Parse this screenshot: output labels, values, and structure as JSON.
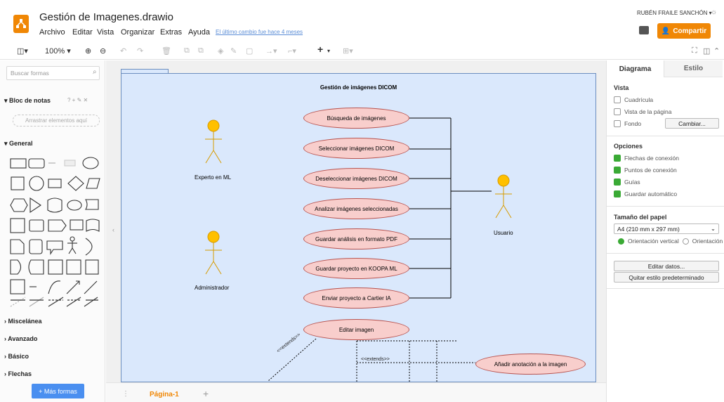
{
  "app": {
    "title": "Gestión de Imagenes.drawio",
    "last_change": "El último cambio fue hace 4 meses",
    "user": "RUBÉN FRAILE SANCHÓN ▾",
    "share": "Compartir"
  },
  "menu": [
    "Archivo",
    "Editar",
    "Vista",
    "Organizar",
    "Extras",
    "Ayuda"
  ],
  "toolbar": {
    "zoom": "100% ▾"
  },
  "left": {
    "search_placeholder": "Buscar formas",
    "scratchpad": "Bloc de notas",
    "scratchpad_tools": "? + ✎ ✕",
    "drag_hint": "Arrastrar elementos aquí",
    "general": "General",
    "sections": [
      "Miscelánea",
      "Avanzado",
      "Básico",
      "Flechas"
    ],
    "more_shapes": "+ Más formas"
  },
  "diagram": {
    "title": "Gestión de imágenes DICOM",
    "actors": [
      "Experto en ML",
      "Administrador",
      "Usuario"
    ],
    "use_cases": [
      "Búsqueda de imágenes",
      "Seleccionar imágenes DICOM",
      "Deseleccionar imágenes DICOM",
      "Analizar imágenes seleccionadas",
      "Guardar análisis en formato PDF",
      "Guardar proyecto en KOOPA ML",
      "Enviar proyecto a Cartier IA",
      "Editar imagen",
      "Añadir anotación a la imagen"
    ],
    "extends_1": "<<extends>>",
    "extends_2": "<<extends>>"
  },
  "bottom": {
    "page": "Página-1",
    "add": "+"
  },
  "right": {
    "tabs": [
      "Diagrama",
      "Estilo"
    ],
    "vista": "Vista",
    "grid": "Cuadrícula",
    "page_view": "Vista de la página",
    "background": "Fondo",
    "change": "Cambiar...",
    "options": "Opciones",
    "options_items": [
      "Flechas de conexión",
      "Puntos de conexión",
      "Guías",
      "Guardar automático"
    ],
    "paper": "Tamaño del papel",
    "paper_value": "A4 (210 mm x 297 mm)",
    "portrait": "Orientación vertical",
    "landscape": "Orientación",
    "edit_data": "Editar datos...",
    "clear_style": "Quitar estilo predeterminado"
  },
  "colors": {
    "accent": "#f08705",
    "usecase_fill": "#f8cecc",
    "usecase_stroke": "#b85450",
    "container_fill": "#dae8fc",
    "actor": "#ffc000",
    "link": "#4a8ff0"
  }
}
